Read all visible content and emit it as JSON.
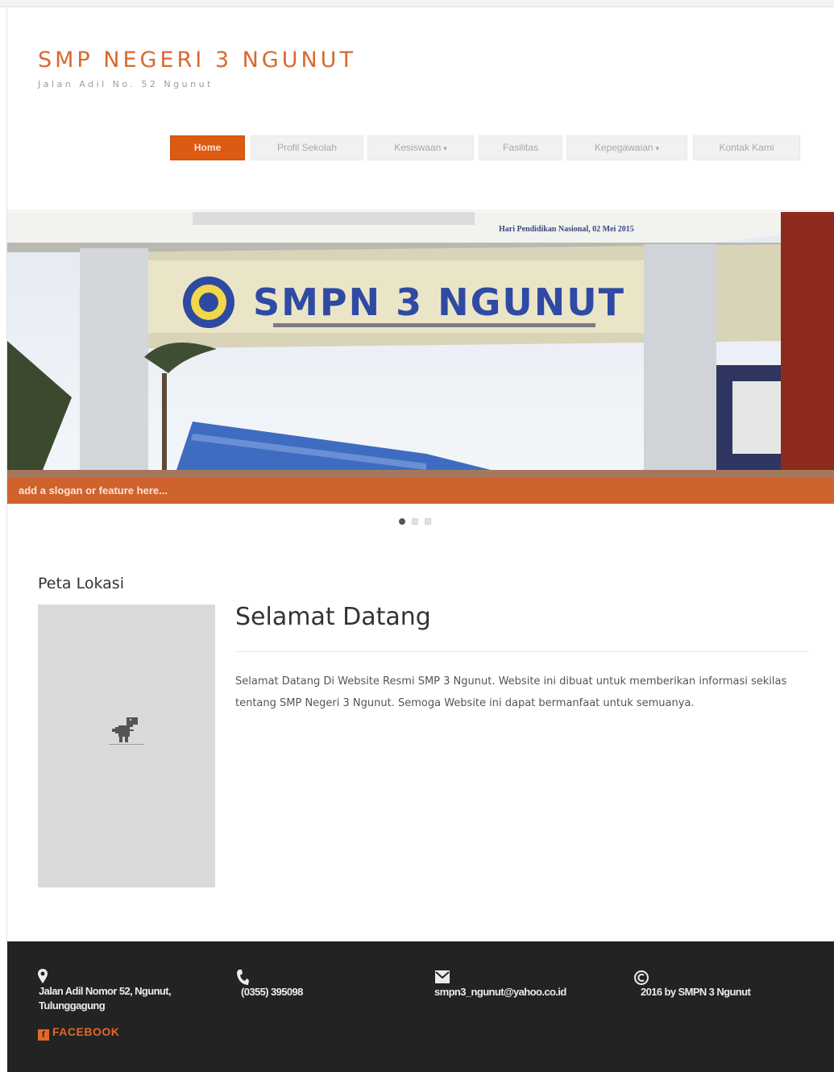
{
  "site": {
    "title": "SMP NEGERI 3 NGUNUT",
    "tagline": "Jalan Adil No. 52 Ngunut"
  },
  "nav": {
    "items": [
      {
        "label": "Home",
        "active": true
      },
      {
        "label": "Profil Sekolah"
      },
      {
        "label": "Kesiswaan",
        "dropdown": true
      },
      {
        "label": "Fasilitas"
      },
      {
        "label": "Kepegawaian",
        "dropdown": true
      },
      {
        "label": "Kontak Kami"
      }
    ],
    "caret": "▾"
  },
  "slider": {
    "banner_text": "Hari Pendidikan Nasional, 02 Mei 2015",
    "sign_text": "SMPN 3 NGUNUT",
    "caption": "add a slogan or feature here...",
    "active_slide": 1,
    "slide_count": 3
  },
  "sidebar": {
    "title": "Peta Lokasi",
    "map_icon": "dino-icon"
  },
  "main": {
    "title": "Selamat Datang",
    "body": "Selamat Datang Di Website Resmi SMP 3 Ngunut. Website ini dibuat untuk memberikan informasi sekilas tentang SMP Negeri 3 Ngunut. Semoga Website ini dapat bermanfaat untuk semuanya."
  },
  "footer": {
    "address": "Jalan Adil Nomor 52, Ngunut, Tulunggagung",
    "phone": "(0355) 395098",
    "email": "smpn3_ngunut@yahoo.co.id",
    "copyright": "2016 by SMPN 3 Ngunut",
    "facebook": "FACEBOOK",
    "accent": "#e2672a"
  },
  "colors": {
    "brand": "#d8692e",
    "nav_active": "#dd5a12",
    "footer_bg": "#232323"
  }
}
